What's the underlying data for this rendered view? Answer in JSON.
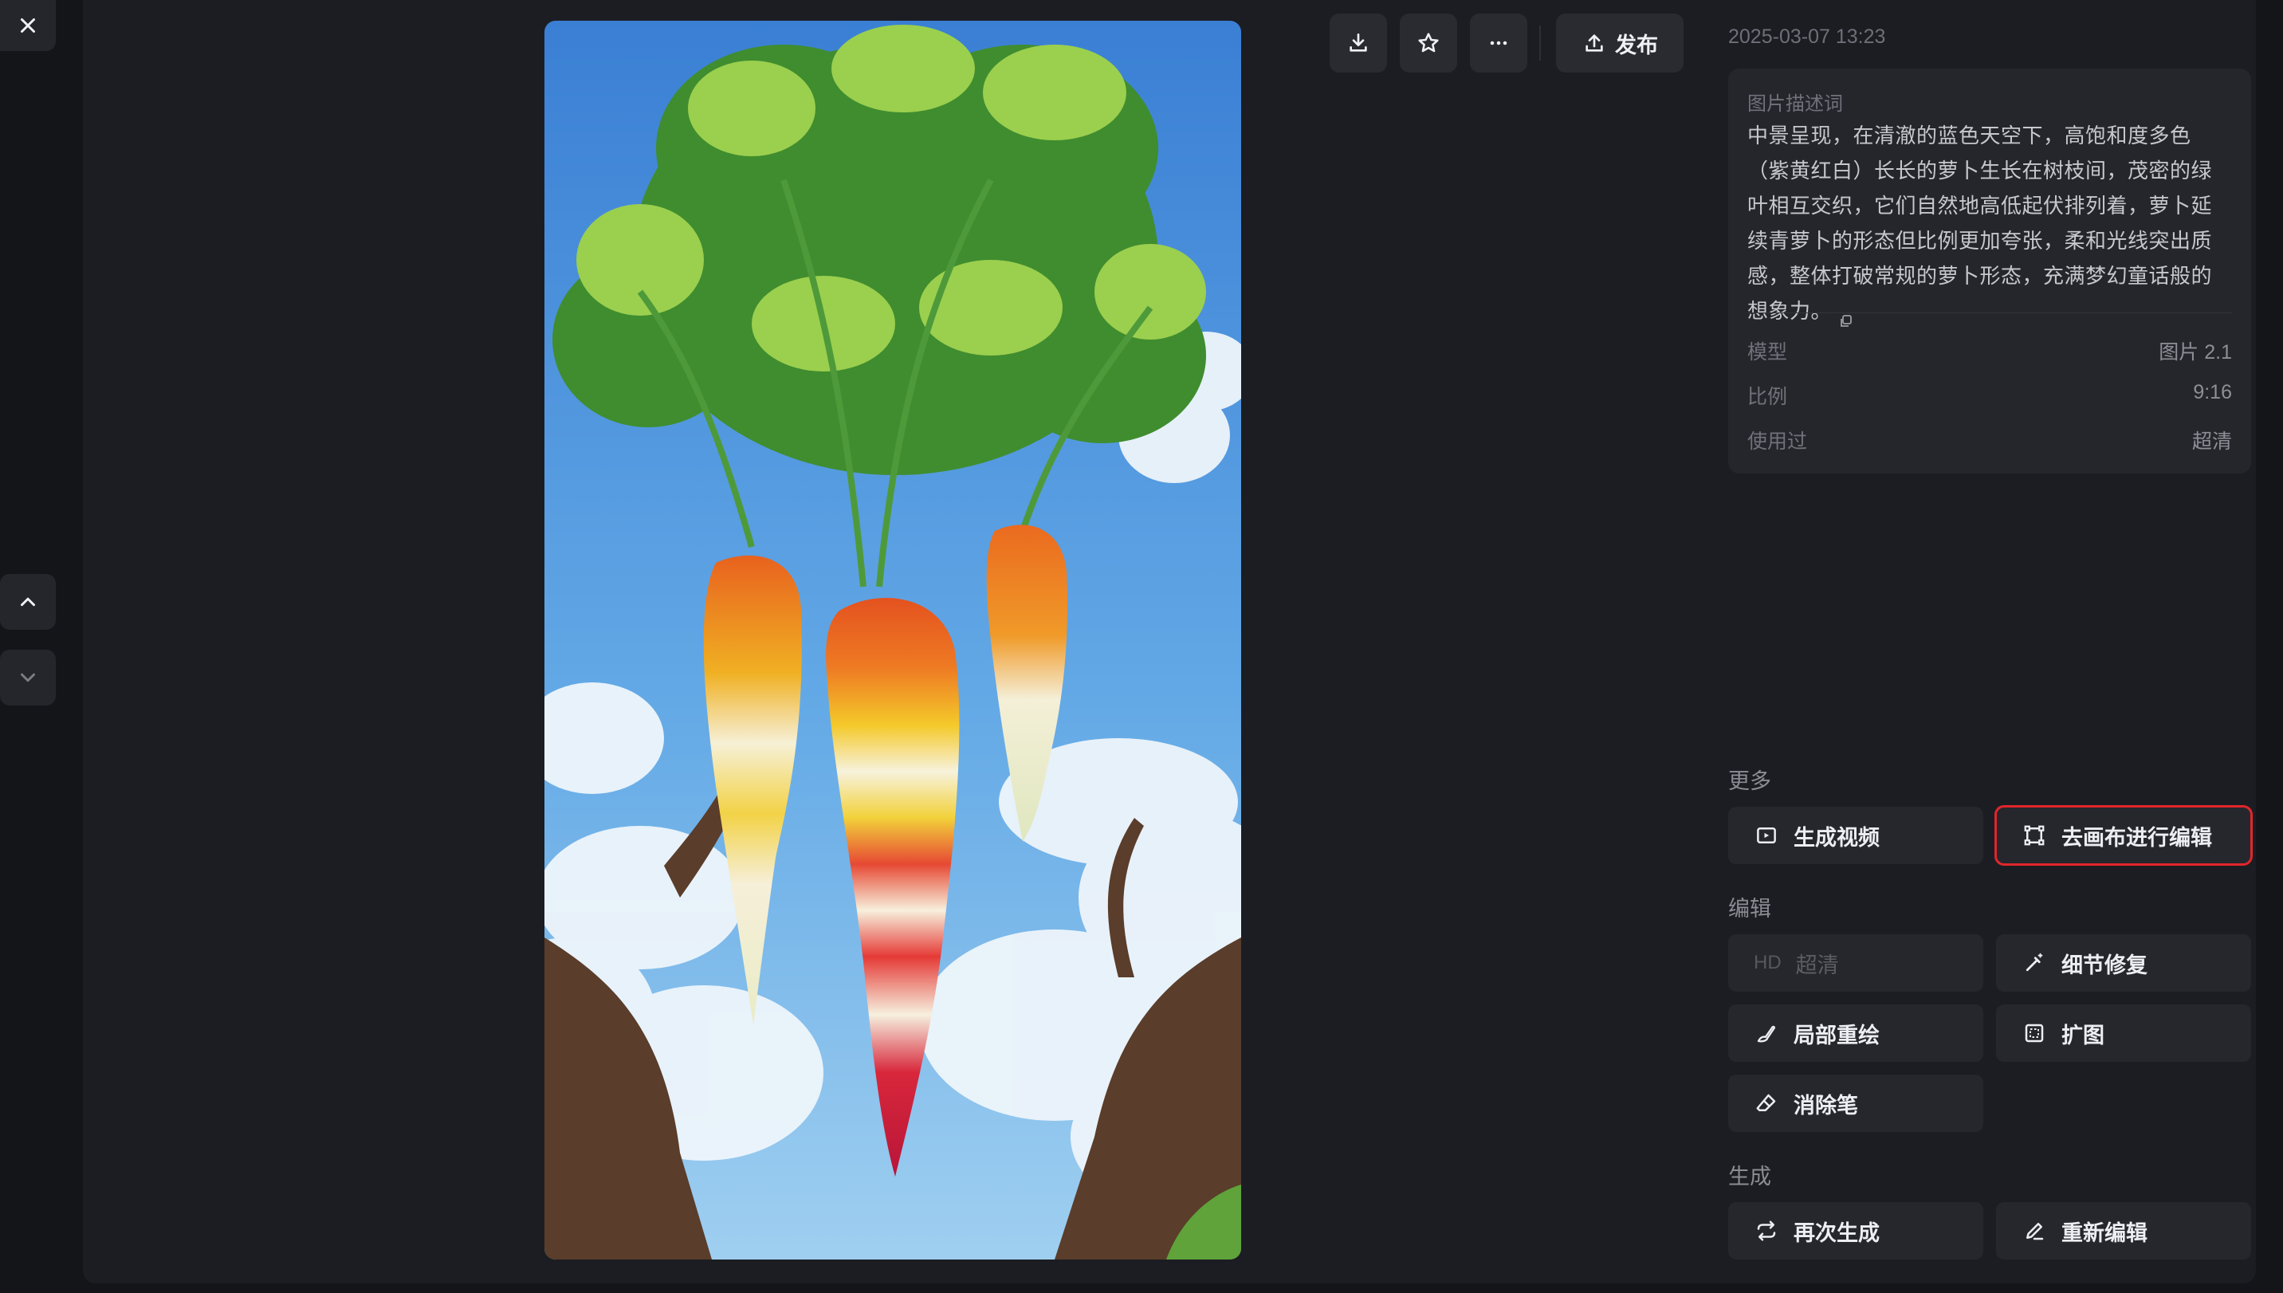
{
  "image": {
    "alt": "",
    "colors": {
      "sky_top": "#3f86d8",
      "sky_bottom": "#8cc5ee",
      "accent_red": "#e0262b"
    }
  },
  "toolbar": {
    "download_icon": "download-icon",
    "favorite_icon": "star-icon",
    "more_icon": "more-icon",
    "publish_label": "发布"
  },
  "details": {
    "timestamp": "2025-03-07 13:23",
    "prompt_label": "图片描述词",
    "prompt_text": "中景呈现，在清澈的蓝色天空下，高饱和度多色（紫黄红白）长长的萝卜生长在树枝间，茂密的绿叶相互交织，它们自然地高低起伏排列着，萝卜延续青萝卜的形态但比例更加夸张，柔和光线突出质感，整体打破常规的萝卜形态，充满梦幻童话般的想象力。",
    "meta": [
      {
        "key": "模型",
        "value": "图片 2.1"
      },
      {
        "key": "比例",
        "value": "9:16"
      },
      {
        "key": "使用过",
        "value": "超清"
      }
    ]
  },
  "sections": {
    "more": {
      "title": "更多",
      "generate_video": "生成视频",
      "canvas_edit": "去画布进行编辑"
    },
    "edit": {
      "title": "编辑",
      "hd_badge": "HD",
      "hd_label": "超清",
      "detail_fix": "细节修复",
      "local_redraw": "局部重绘",
      "expand": "扩图",
      "eraser": "消除笔"
    },
    "generate": {
      "title": "生成",
      "regenerate": "再次生成",
      "re_edit": "重新编辑"
    }
  }
}
